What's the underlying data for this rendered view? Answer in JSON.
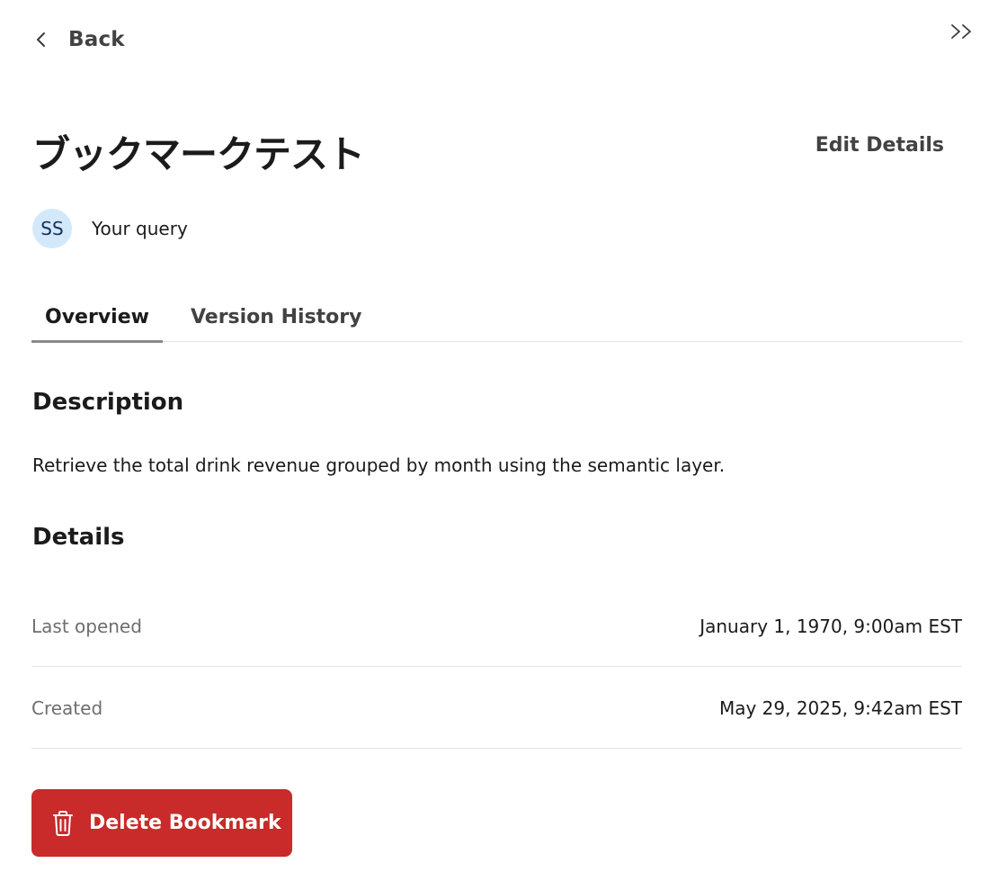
{
  "header": {
    "back_label": "Back",
    "collapse_label": ">>"
  },
  "title": "ブックマークテスト",
  "edit_details_label": "Edit Details",
  "owner": {
    "initials": "SS",
    "label": "Your query"
  },
  "tabs": [
    {
      "label": "Overview",
      "active": true
    },
    {
      "label": "Version History",
      "active": false
    }
  ],
  "description": {
    "heading": "Description",
    "text": "Retrieve the total drink revenue grouped by month using the semantic layer."
  },
  "details": {
    "heading": "Details",
    "rows": [
      {
        "label": "Last opened",
        "value": "January 1, 1970, 9:00am EST"
      },
      {
        "label": "Created",
        "value": "May 29, 2025, 9:42am EST"
      }
    ]
  },
  "delete_button": {
    "label": "Delete Bookmark",
    "icon": "trash-icon",
    "color": "#c92a2a"
  }
}
